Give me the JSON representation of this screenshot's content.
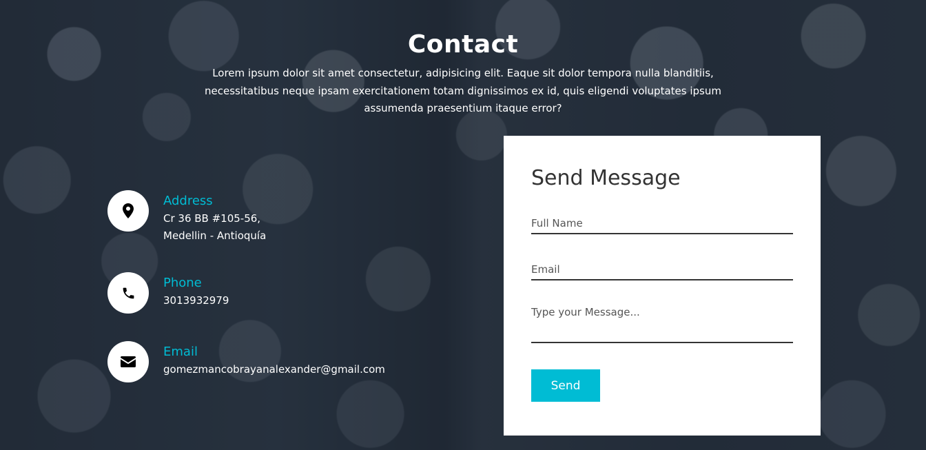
{
  "header": {
    "title": "Contact",
    "subtitle": "Lorem ipsum dolor sit amet consectetur, adipisicing elit. Eaque sit dolor tempora nulla blanditiis, necessitatibus neque ipsam exercitationem totam dignissimos ex id, quis eligendi voluptates ipsum assumenda praesentium itaque error?"
  },
  "contact_info": [
    {
      "icon": "map-marker-icon",
      "label": "Address",
      "lines": [
        "Cr 36 BB #105-56,",
        "Medellin - Antioquía"
      ]
    },
    {
      "icon": "phone-icon",
      "label": "Phone",
      "lines": [
        "3013932979"
      ]
    },
    {
      "icon": "envelope-icon",
      "label": "Email",
      "lines": [
        "gomezmancobrayanalexander@gmail.com"
      ]
    }
  ],
  "form": {
    "title": "Send Message",
    "name_placeholder": "Full Name",
    "email_placeholder": "Email",
    "message_placeholder": "Type your Message...",
    "submit_label": "Send"
  },
  "colors": {
    "accent": "#00bcd4",
    "text_light": "#ffffff",
    "text_dark": "#333333"
  }
}
